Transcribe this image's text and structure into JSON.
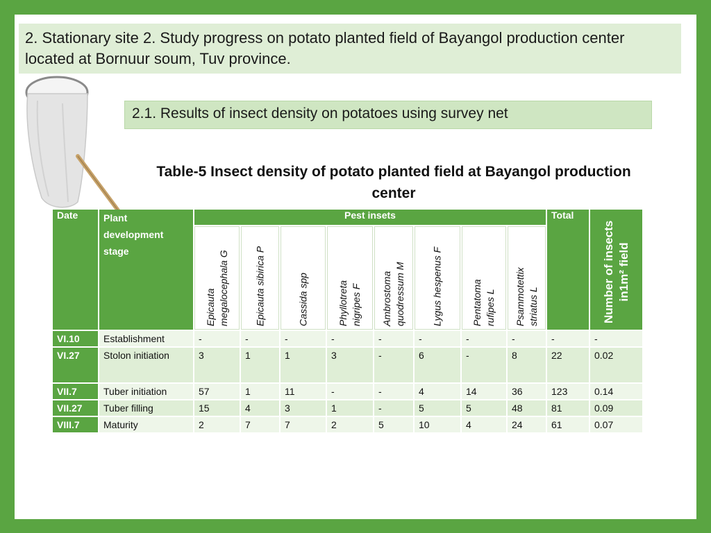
{
  "slide_title": "2. Stationary site 2. Study progress on potato planted field of Bayangol production center located at Bornuur soum, Tuv province.",
  "subtitle": "2.1. Results of insect density on potatoes using survey net",
  "table_title": "Table-5 Insect density of potato planted field at Bayangol production center",
  "colors": {
    "frame": "#5aa542",
    "header": "#5aa542",
    "row_light": "#dfeed6"
  },
  "table": {
    "headers": {
      "date": "Date",
      "stage": "Plant development stage",
      "pests_group": "Pest insets",
      "total": "Total",
      "density_line1": "Number  of  insects",
      "density_line2": "in1m² field"
    },
    "pests": [
      {
        "line1": "Epicauta",
        "line2": "megalocephala G"
      },
      {
        "line1": "Epicauta sibirica P",
        "line2": ""
      },
      {
        "line1": "Cassida spp",
        "line2": ""
      },
      {
        "line1": "Phyllotreta",
        "line2": "nigripes F"
      },
      {
        "line1": "Ambrostoma",
        "line2": "quodressum M"
      },
      {
        "line1": "Lygus hespenus F",
        "line2": ""
      },
      {
        "line1": "Pentatoma",
        "line2": "rufipes L"
      },
      {
        "line1": "Psammotettix",
        "line2": "striatus  L"
      }
    ],
    "rows": [
      {
        "date": "VI.10",
        "stage": "Establishment",
        "values": [
          "-",
          "-",
          "-",
          "-",
          "-",
          "-",
          "-",
          "-"
        ],
        "total": "-",
        "density": "-"
      },
      {
        "date": "VI.27",
        "stage": "Stolon initiation",
        "values": [
          "3",
          "1",
          "1",
          "3",
          "-",
          "6",
          "-",
          "8"
        ],
        "total": "22",
        "density": "0.02"
      },
      {
        "date": "VII.7",
        "stage": "Tuber initiation",
        "values": [
          "57",
          "1",
          "11",
          "-",
          "-",
          "4",
          "14",
          "36"
        ],
        "total": "123",
        "density": "0.14"
      },
      {
        "date": "VII.27",
        "stage": "Tuber filling",
        "values": [
          "15",
          "4",
          "3",
          "1",
          "-",
          "5",
          "5",
          "48"
        ],
        "total": "81",
        "density": "0.09"
      },
      {
        "date": "VIII.7",
        "stage": "Maturity",
        "values": [
          "2",
          "7",
          "7",
          "2",
          "5",
          "10",
          "4",
          "24"
        ],
        "total": "61",
        "density": "0.07"
      }
    ]
  }
}
